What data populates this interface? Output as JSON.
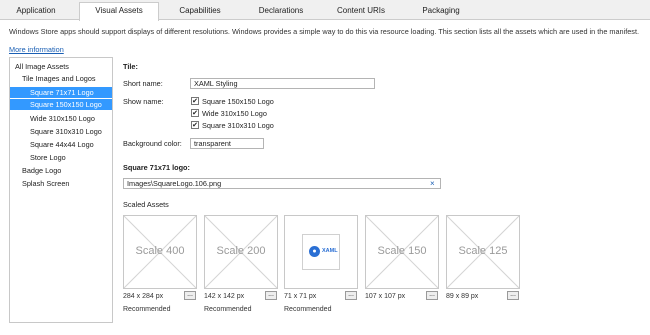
{
  "tabs": [
    {
      "label": "Application",
      "active": false
    },
    {
      "label": "Visual Assets",
      "active": true
    },
    {
      "label": "Capabilities",
      "active": false
    },
    {
      "label": "Declarations",
      "active": false
    },
    {
      "label": "Content URIs",
      "active": false
    },
    {
      "label": "Packaging",
      "active": false
    }
  ],
  "description": "Windows Store apps should support displays of different resolutions. Windows provides a simple way to do this via resource loading. This section lists all the assets which are used in the manifest.",
  "more_info_link": "More information",
  "tree": {
    "items": [
      {
        "label": "All Image Assets",
        "selected": false
      },
      {
        "label": "Tile Images and Logos",
        "selected": false
      },
      {
        "label": "Square 71x71 Logo",
        "selected": true
      },
      {
        "label": "Square 150x150 Logo",
        "selected": true
      },
      {
        "label": "Wide 310x150 Logo",
        "selected": false
      },
      {
        "label": "Square 310x310 Logo",
        "selected": false
      },
      {
        "label": "Square 44x44 Logo",
        "selected": false
      },
      {
        "label": "Store Logo",
        "selected": false
      },
      {
        "label": "Badge Logo",
        "selected": false
      },
      {
        "label": "Splash Screen",
        "selected": false
      }
    ]
  },
  "tile": {
    "heading": "Tile:",
    "short_name_label": "Short name:",
    "short_name_value": "XAML Styling",
    "show_name_label": "Show name:",
    "show_name_options": [
      {
        "label": "Square 150x150 Logo",
        "checked": true
      },
      {
        "label": "Wide 310x150 Logo",
        "checked": true
      },
      {
        "label": "Square 310x310 Logo",
        "checked": true
      }
    ],
    "background_color_label": "Background color:",
    "background_color_value": "transparent"
  },
  "logo_section": {
    "heading": "Square 71x71 logo:",
    "path_value": "Images\\SquareLogo.106.png",
    "clear_glyph": "×",
    "scaled_assets_label": "Scaled Assets"
  },
  "assets": [
    {
      "scale": "Scale 400",
      "dims": "284 x 284 px",
      "note": "Recommended",
      "has_image": false
    },
    {
      "scale": "Scale 200",
      "dims": "142 x 142 px",
      "note": "Recommended",
      "has_image": false
    },
    {
      "scale": "",
      "dims": "71 x 71 px",
      "note": "Recommended",
      "has_image": true,
      "image_text": "XAML"
    },
    {
      "scale": "Scale 150",
      "dims": "107 x 107 px",
      "note": "",
      "has_image": false
    },
    {
      "scale": "Scale 125",
      "dims": "89 x 89 px",
      "note": "",
      "has_image": false
    }
  ],
  "browse_glyph": "...",
  "check_glyph": "✔",
  "colors": {
    "selection": "#3399ff",
    "link": "#1a5fb4",
    "xaml_blue": "#2a6fd4"
  },
  "icons": {
    "placeholder": "crossed-box-icon",
    "logo": "xaml-logo-icon"
  }
}
